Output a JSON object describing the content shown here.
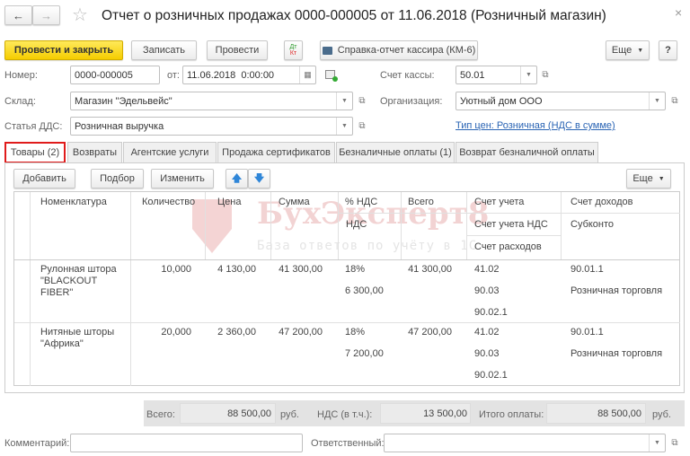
{
  "window": {
    "title": "Отчет о розничных продажах 0000-000005 от 11.06.2018 (Розничный магазин)",
    "back_icon": "arrow-left",
    "forward_icon": "arrow-right",
    "favorite_icon": "star",
    "close_label": "×"
  },
  "toolbar": {
    "post_close": "Провести и закрыть",
    "save": "Записать",
    "post": "Провести",
    "dtkt_top": "Дт",
    "dtkt_bottom": "Кт",
    "report": "Справка-отчет кассира (КМ-6)",
    "more": "Еще",
    "help": "?"
  },
  "form": {
    "number_label": "Номер:",
    "number": "0000-000005",
    "date_label": "от:",
    "date": "11.06.2018  0:00:00",
    "cash_account_label": "Счет кассы:",
    "cash_account": "50.01",
    "warehouse_label": "Склад:",
    "warehouse": "Магазин \"Эдельвейс\"",
    "org_label": "Организация:",
    "org": "Уютный дом ООО",
    "dds_label": "Статья ДДС:",
    "dds": "Розничная выручка",
    "price_type_link": "Тип цен: Розничная (НДС в сумме)"
  },
  "tabs": [
    {
      "label": "Товары (2)",
      "active": true
    },
    {
      "label": "Возвраты"
    },
    {
      "label": "Агентские услуги"
    },
    {
      "label": "Продажа сертификатов"
    },
    {
      "label": "Безналичные оплаты (1)"
    },
    {
      "label": "Возврат безналичной оплаты"
    }
  ],
  "table_toolbar": {
    "add": "Добавить",
    "pick": "Подбор",
    "edit": "Изменить",
    "more": "Еще"
  },
  "table": {
    "headers": {
      "name": "Номенклатура",
      "qty": "Количество",
      "price": "Цена",
      "sum": "Сумма",
      "vat_rate": "% НДС",
      "vat": "НДС",
      "total": "Всего",
      "account": "Счет учета",
      "vat_account": "Счет учета НДС",
      "expense_account": "Счет расходов",
      "income_account": "Счет доходов",
      "subconto": "Субконто"
    },
    "rows": [
      {
        "name": "Рулонная штора \"BLACKOUT FIBER\"",
        "qty": "10,000",
        "price": "4 130,00",
        "sum": "41 300,00",
        "vat_rate": "18%",
        "vat": "6 300,00",
        "total": "41 300,00",
        "account": "41.02",
        "vat_account": "90.03",
        "expense_account": "90.02.1",
        "income_account": "90.01.1",
        "subconto": "Розничная торговля"
      },
      {
        "name": "Нитяные шторы \"Африка\"",
        "qty": "20,000",
        "price": "2 360,00",
        "sum": "47 200,00",
        "vat_rate": "18%",
        "vat": "7 200,00",
        "total": "47 200,00",
        "account": "41.02",
        "vat_account": "90.03",
        "expense_account": "90.02.1",
        "income_account": "90.01.1",
        "subconto": "Розничная торговля"
      }
    ]
  },
  "watermark": {
    "title": "БухЭксперт8",
    "subtitle": "База ответов по учёту в 1С"
  },
  "totals": {
    "total_label": "Всего:",
    "total": "88 500,00",
    "currency": "руб.",
    "vat_label": "НДС (в т.ч.):",
    "vat": "13 500,00",
    "pay_label": "Итого оплаты:",
    "pay": "88 500,00",
    "pay_currency": "руб."
  },
  "bottom": {
    "comment_label": "Комментарий:",
    "comment": "",
    "responsible_label": "Ответственный:",
    "responsible": ""
  }
}
